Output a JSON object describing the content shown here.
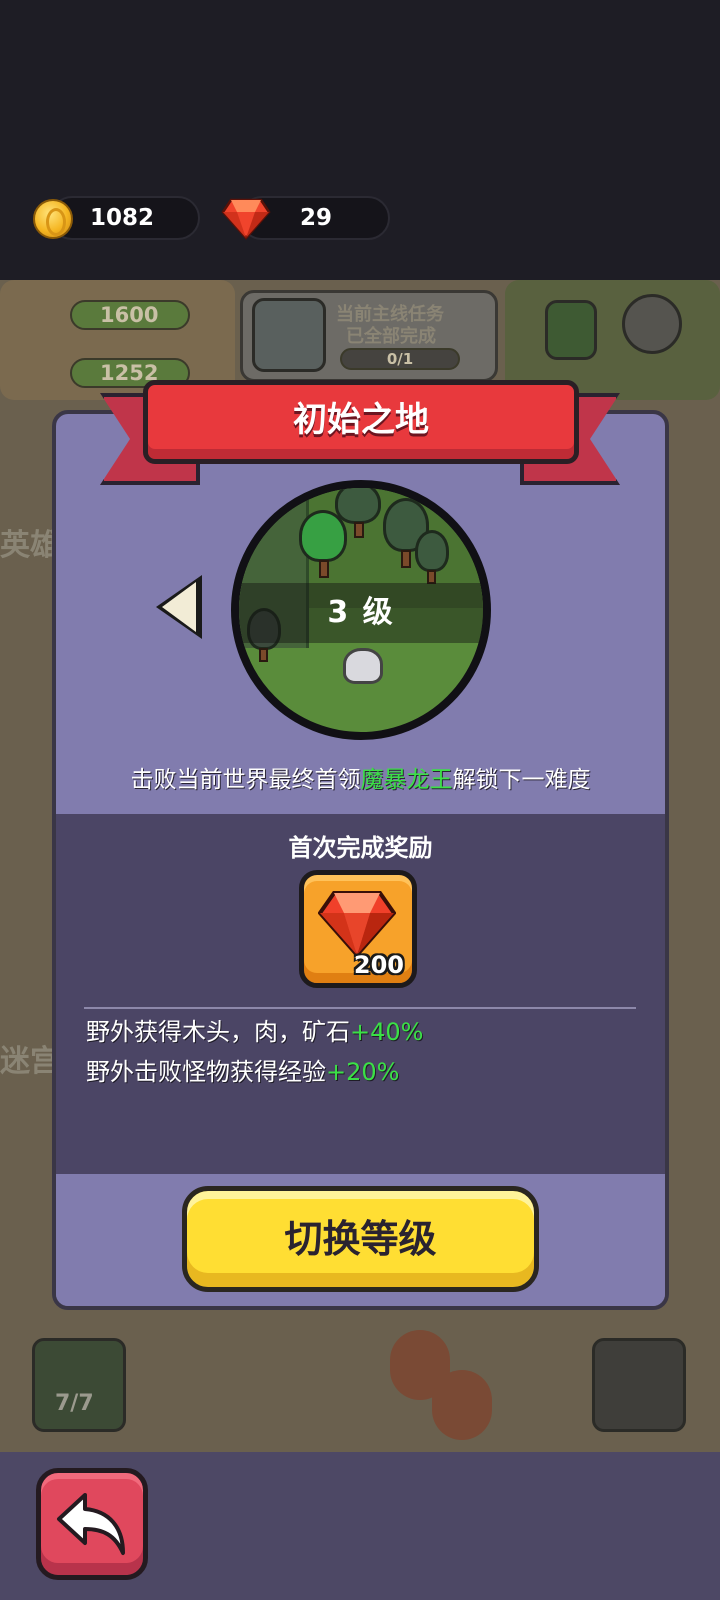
{
  "resources": {
    "coins": "1082",
    "gems": "29"
  },
  "background": {
    "meat": "1600",
    "wood": "1252",
    "quest_text_1": "当前主线任务",
    "quest_text_2": "已全部完成",
    "quest_progress": "0/1",
    "hero_label": "英雄",
    "maze_label": "迷宫",
    "slot_count": "7/7"
  },
  "modal": {
    "title": "初始之地",
    "level_label": "3 级",
    "unlock_prefix": "击败当前世界最终首领",
    "boss_name": "魔暴龙王",
    "unlock_suffix": "解锁下一难度",
    "reward_title": "首次完成奖励",
    "reward_count": "200",
    "bonus_1_text": "野外获得木头，肉，矿石",
    "bonus_1_pct": "+40%",
    "bonus_2_text": "野外击败怪物获得经验",
    "bonus_2_pct": "+20%",
    "switch_button": "切换等级"
  },
  "colors": {
    "highlight_green": "#3be046",
    "ribbon_red": "#e8393d",
    "button_yellow": "#ffde33"
  }
}
